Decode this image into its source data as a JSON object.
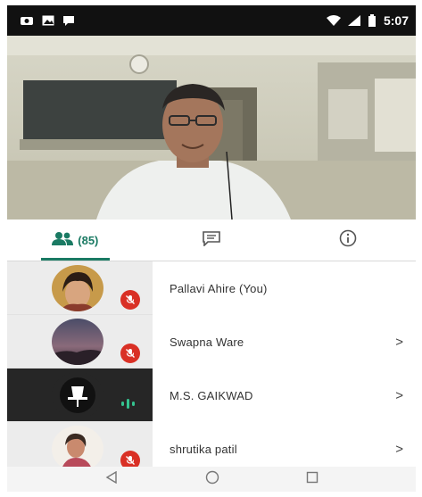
{
  "status_bar": {
    "time": "5:07",
    "left_icons": [
      "camera-notification-icon",
      "image-notification-icon",
      "chat-notification-icon"
    ],
    "right_icons": [
      "wifi-icon",
      "signal-icon",
      "battery-icon"
    ]
  },
  "video": {
    "description_icon": "speaker-video-feed"
  },
  "tabs": {
    "people_count": "(85)",
    "items": [
      {
        "icon": "people-icon",
        "label": "(85)",
        "active": true
      },
      {
        "icon": "chat-icon",
        "label": "",
        "active": false
      },
      {
        "icon": "info-icon",
        "label": "",
        "active": false
      }
    ]
  },
  "participants": [
    {
      "name": "Pallavi Ahire (You)",
      "status": "muted",
      "chevron": false
    },
    {
      "name": "Swapna Ware",
      "status": "muted",
      "chevron": true
    },
    {
      "name": "M.S. GAIKWAD",
      "status": "speaking",
      "chevron": true
    },
    {
      "name": "shrutika patil",
      "status": "muted",
      "chevron": true
    }
  ],
  "chevron_glyph": ">",
  "colors": {
    "accent": "#1a7a63",
    "mute_red": "#d93025",
    "speaking_green": "#34c38f"
  },
  "nav": [
    "back-icon",
    "home-icon",
    "recents-icon"
  ]
}
